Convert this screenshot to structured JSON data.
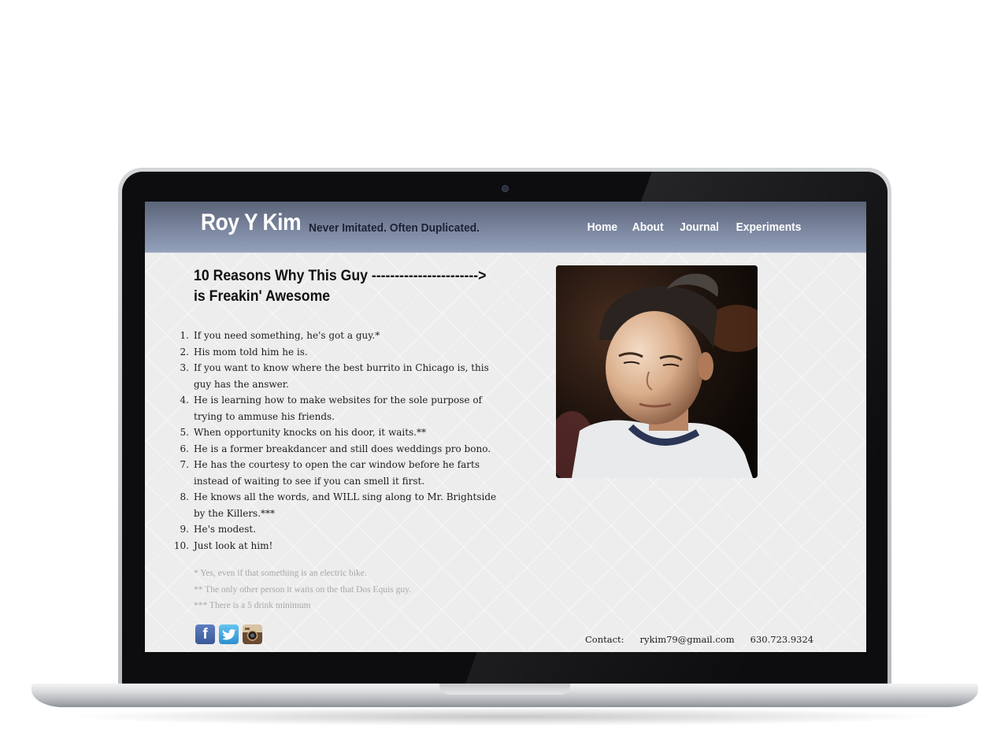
{
  "site": {
    "title": "Roy Y Kim",
    "tagline": "Never Imitated. Often Duplicated."
  },
  "nav": [
    {
      "label": "Home"
    },
    {
      "label": "About"
    },
    {
      "label": "Journal"
    },
    {
      "label": "Experiments"
    }
  ],
  "main": {
    "headline_line1": "10 Reasons Why This Guy ----------------------->",
    "headline_line2": "is Freakin' Awesome",
    "reasons": [
      "If you need something, he's got a guy.*",
      "His mom told him he is.",
      "If you want to know where the best burrito in Chicago is, this guy has the answer.",
      "He is learning how to make websites for the sole purpose of trying to ammuse his friends.",
      "When opportunity knocks on his door, it waits.**",
      "He is a former breakdancer and still does weddings pro bono.",
      "He has the courtesy to open the car window before he farts instead of waiting to see if you can smell it first.",
      "He knows all the words, and WILL sing along to Mr. Brightside by the Killers.***",
      "He's modest.",
      "Just look at him!"
    ],
    "footnotes": [
      "* Yes, even if that something is an electric bike.",
      "** The only other person it waits on the that Dos Equis guy.",
      "*** There is a 5 drink minimum"
    ]
  },
  "social": [
    {
      "name": "facebook",
      "icon": "facebook-icon"
    },
    {
      "name": "twitter",
      "icon": "twitter-icon"
    },
    {
      "name": "instagram",
      "icon": "instagram-icon"
    }
  ],
  "contact": {
    "label": "Contact:",
    "email": "rykim79@gmail.com",
    "phone": "630.723.9324"
  },
  "colors": {
    "header_top": "#5a6378",
    "header_bottom": "#93a0b9",
    "page_bg": "#ededee"
  }
}
